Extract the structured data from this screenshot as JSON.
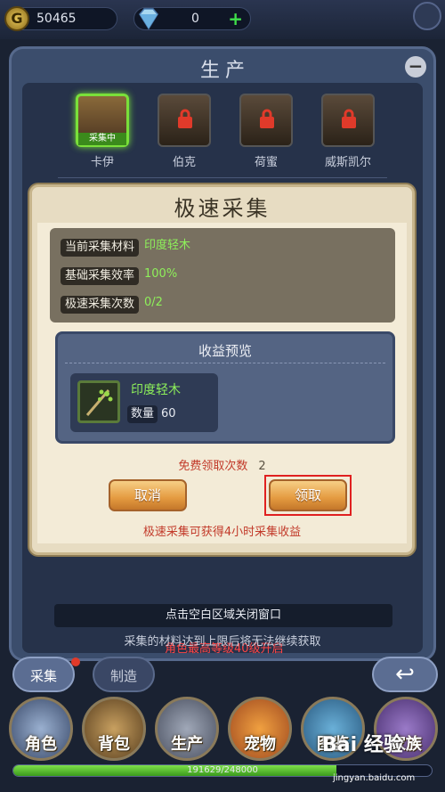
{
  "resources": {
    "gold": "50465",
    "gems": "0",
    "gem_plus": "+"
  },
  "panel": {
    "title": "生产",
    "heroes": [
      {
        "name": "卡伊",
        "status": "采集中",
        "active": true
      },
      {
        "name": "伯克",
        "locked": true
      },
      {
        "name": "荷蜜",
        "locked": true
      },
      {
        "name": "威斯凯尔",
        "locked": true
      }
    ],
    "close_hint": "点击空白区域关闭窗口",
    "lock_message": "角色最高等级40级开启",
    "footer_hint": "采集的材料达到上限后将无法继续获取"
  },
  "modal": {
    "title": "极速采集",
    "info": [
      {
        "label": "当前采集材料",
        "value": "印度轻木"
      },
      {
        "label": "基础采集效率",
        "value": "100%"
      },
      {
        "label": "极速采集次数",
        "value": "0/2"
      }
    ],
    "preview": {
      "title": "收益预览",
      "item": {
        "name": "印度轻木",
        "qty_label": "数量",
        "qty": "60"
      }
    },
    "free_label": "免费领取次数",
    "free_count": "2",
    "cancel": "取消",
    "claim": "领取",
    "tip": "极速采集可获得4小时采集收益"
  },
  "tabs": {
    "collect": "采集",
    "make": "制造"
  },
  "nav": [
    "角色",
    "背包",
    "生产",
    "宠物",
    "图鉴",
    "家族"
  ],
  "xp": {
    "text": "191629/248000",
    "progress": 0.773
  },
  "watermark": {
    "brand": "Bai 经验",
    "url": "jingyan.baidu.com"
  },
  "colors": {
    "highlight": "#8ef05a",
    "warning": "#c23a2a",
    "button": "#e49a40"
  }
}
